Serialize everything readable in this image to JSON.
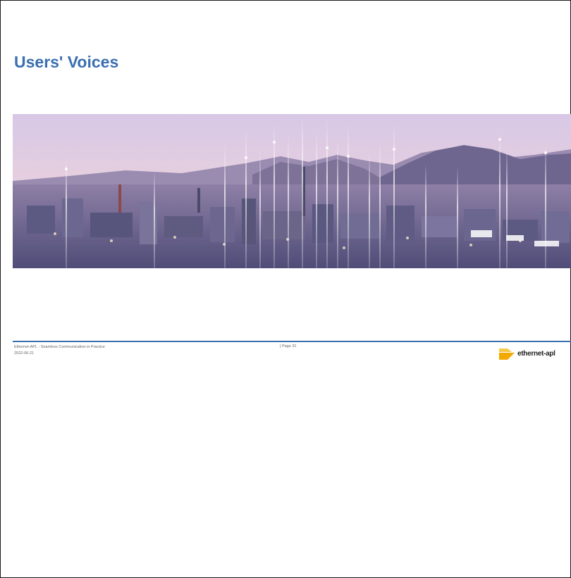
{
  "slide": {
    "title": "Users' Voices"
  },
  "footer": {
    "document_title": "Ethernet-APL  - Seamless Communication  in Practice",
    "date": "2022-06-21",
    "page_label": "| Page 31"
  },
  "logo": {
    "wordmark": "ethernet-apl"
  },
  "colors": {
    "title": "#3a6fb0",
    "rule": "#3a6fb0",
    "logo_accent": "#f2a900"
  }
}
